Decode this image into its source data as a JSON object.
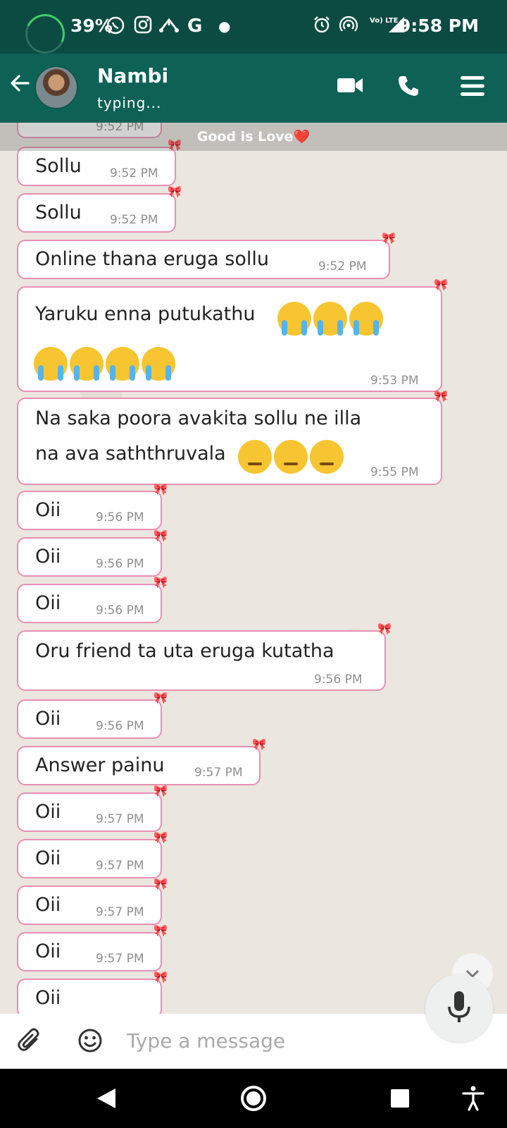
{
  "status_bar": {
    "battery": "39%",
    "time": "9:58 PM",
    "network": "Vo) LTE"
  },
  "header": {
    "contact_name": "Nambi",
    "status": "typing..."
  },
  "banner": {
    "text": "Good is Love❤️"
  },
  "messages": [
    {
      "text": "Sollu",
      "time": "9:52 PM"
    },
    {
      "text": "Sollu",
      "time": "9:52 PM"
    },
    {
      "text": "Online thana eruga sollu",
      "time": "9:52 PM"
    },
    {
      "text": "Yaruku enna putukathu",
      "time": "9:53 PM"
    },
    {
      "text": "Na saka poora avakita sollu ne illa",
      "text2": "na ava saththruvala",
      "time": "9:55 PM"
    },
    {
      "text": "Oii",
      "time": "9:56 PM"
    },
    {
      "text": "Oii",
      "time": "9:56 PM"
    },
    {
      "text": "Oii",
      "time": "9:56 PM"
    },
    {
      "text": "Oru friend ta uta eruga kutatha",
      "time": "9:56 PM"
    },
    {
      "text": "Oii",
      "time": "9:56 PM"
    },
    {
      "text": "Answer painu",
      "time": "9:57 PM"
    },
    {
      "text": "Oii",
      "time": "9:57 PM"
    },
    {
      "text": "Oii",
      "time": "9:57 PM"
    },
    {
      "text": "Oii",
      "time": "9:57 PM"
    },
    {
      "text": "Oii",
      "time": "9:57 PM"
    },
    {
      "text": "Oii",
      "time": ""
    }
  ],
  "partial_top_message": {
    "time": "9:52 PM"
  },
  "input": {
    "placeholder": "Type a message"
  },
  "icons": {
    "status": [
      "whatsapp-icon",
      "instagram-icon",
      "usb-icon",
      "google-icon",
      "dot-icon",
      "alarm-icon",
      "hotspot-icon",
      "signal-icon"
    ],
    "header": [
      "back-arrow-icon",
      "video-call-icon",
      "voice-call-icon",
      "menu-icon"
    ],
    "input": [
      "attach-icon",
      "emoji-icon",
      "mic-icon",
      "chevron-down-icon"
    ],
    "nav": [
      "back-triangle-icon",
      "home-circle-icon",
      "recents-square-icon",
      "accessibility-icon"
    ]
  },
  "colors": {
    "status_bar": "#0b4b41",
    "header": "#0d6155",
    "bubble_border": "#e88fb3",
    "chat_background": "#ebe6df"
  }
}
